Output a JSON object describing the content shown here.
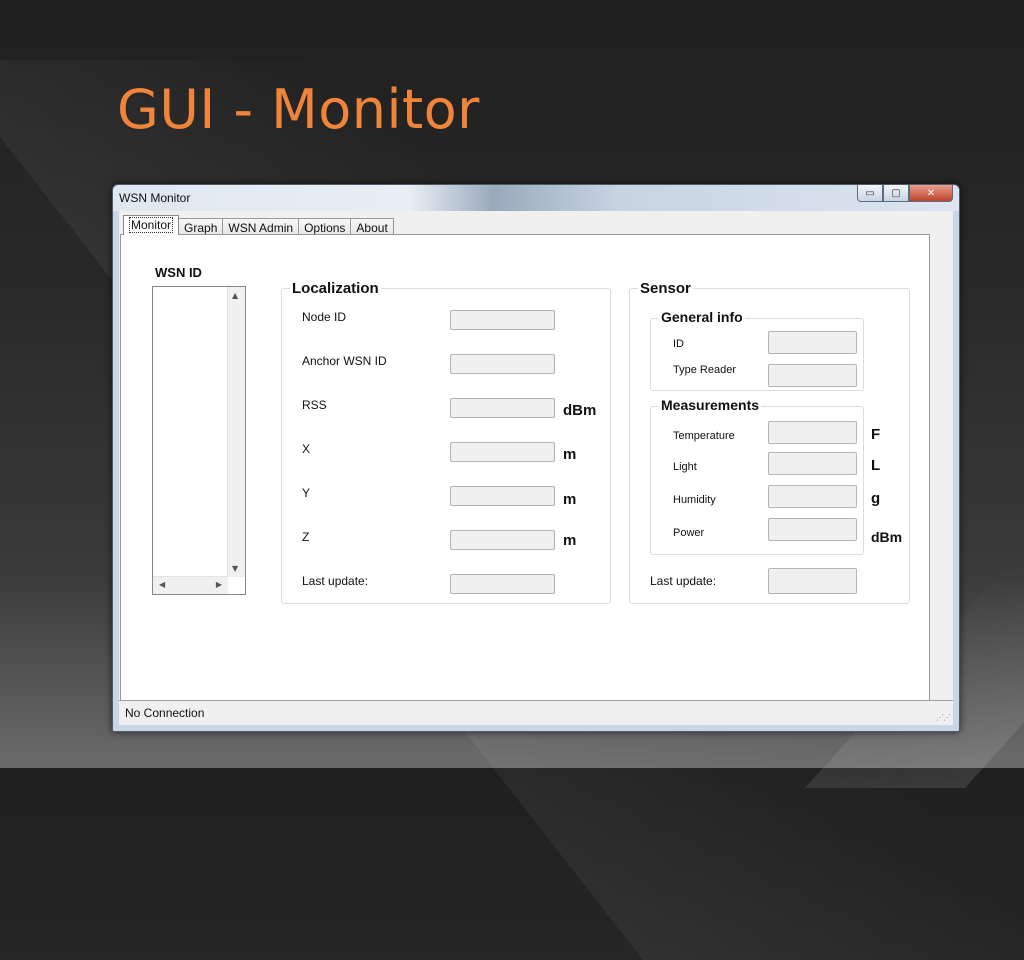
{
  "slide": {
    "title": "GUI - Monitor"
  },
  "window": {
    "title": "WSN Monitor",
    "buttons": {
      "minimize": "▭",
      "maximize": "▢",
      "close": "✕"
    }
  },
  "tabs": [
    {
      "label": "Monitor",
      "active": true
    },
    {
      "label": "Graph"
    },
    {
      "label": "WSN Admin"
    },
    {
      "label": "Options"
    },
    {
      "label": "About"
    }
  ],
  "wsn_list": {
    "label": "WSN ID",
    "items": []
  },
  "localization": {
    "title": "Localization",
    "fields": [
      {
        "label": "Node ID",
        "value": "",
        "unit": ""
      },
      {
        "label": "Anchor WSN ID",
        "value": "",
        "unit": ""
      },
      {
        "label": "RSS",
        "value": "",
        "unit": "dBm"
      },
      {
        "label": "X",
        "value": "",
        "unit": "m"
      },
      {
        "label": "Y",
        "value": "",
        "unit": "m"
      },
      {
        "label": "Z",
        "value": "",
        "unit": "m"
      },
      {
        "label": "Last update:",
        "value": "",
        "unit": ""
      }
    ]
  },
  "sensor": {
    "title": "Sensor",
    "general_info": {
      "title": "General info",
      "fields": [
        {
          "label": "ID",
          "value": ""
        },
        {
          "label": "Type Reader",
          "value": ""
        }
      ]
    },
    "measurements": {
      "title": "Measurements",
      "fields": [
        {
          "label": "Temperature",
          "value": "",
          "unit": "F"
        },
        {
          "label": "Light",
          "value": "",
          "unit": "L"
        },
        {
          "label": "Humidity",
          "value": "",
          "unit": "g"
        },
        {
          "label": "Power",
          "value": "",
          "unit": "dBm"
        }
      ]
    },
    "last_update": {
      "label": "Last update:",
      "value": ""
    }
  },
  "status": {
    "text": "No Connection"
  }
}
